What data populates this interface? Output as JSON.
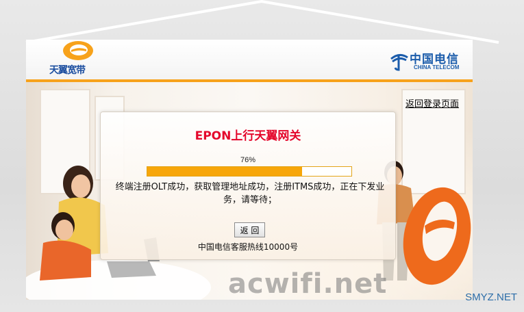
{
  "header": {
    "left_logo_text": "天翼宽带",
    "right_logo_cn": "中国电信",
    "right_logo_en": "CHINA TELECOM"
  },
  "back_to_login_link": "返回登录页面",
  "dialog": {
    "title": "EPON上行天翼网关",
    "progress_percent_text": "76%",
    "progress_value": 0.76,
    "status_message": "终端注册OLT成功，获取管理地址成功，注册ITMS成功，正在下发业务，请等待；",
    "back_button_label": "返 回",
    "hotline": "中国电信客服热线10000号"
  },
  "watermark": "acwifi.net",
  "site_mark": "SMYZ.NET",
  "colors": {
    "title_red": "#e4062b",
    "progress_orange": "#f7a60a",
    "accent_line": "#f7a21b",
    "telecom_blue": "#1b5cab"
  },
  "icons": [
    "tianyi-e-logo-icon",
    "china-telecom-logo-icon",
    "big-e-icon"
  ]
}
